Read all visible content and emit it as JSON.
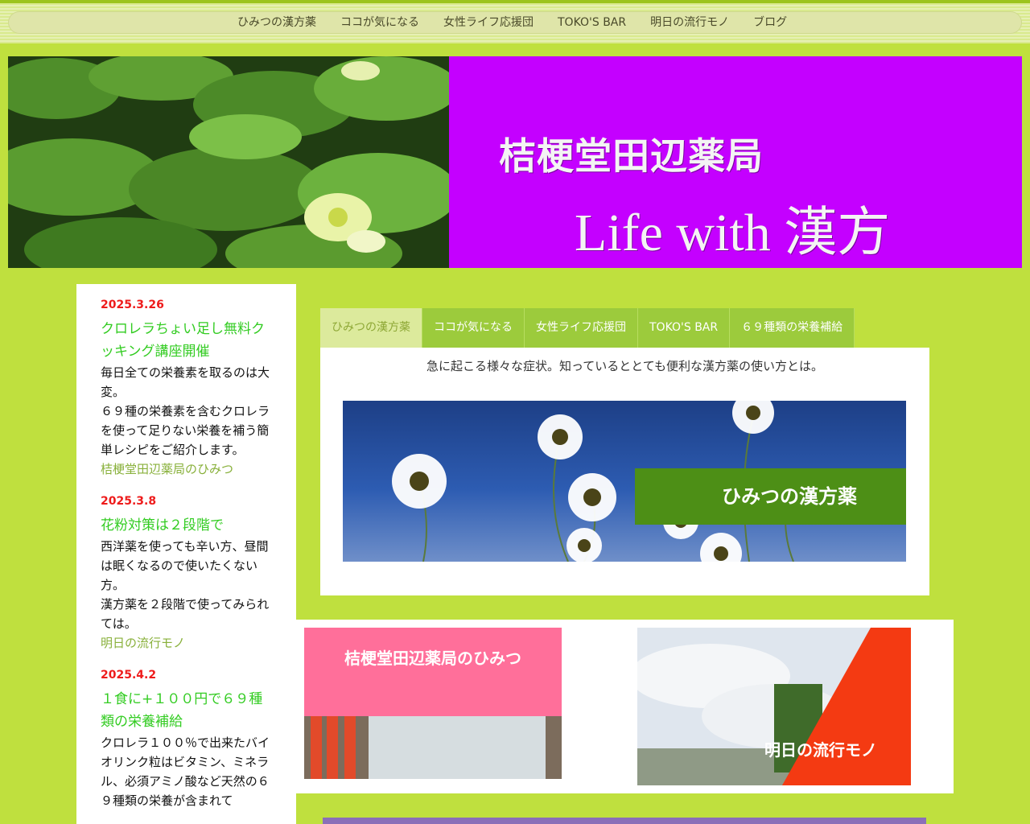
{
  "nav": {
    "items": [
      "ひみつの漢方薬",
      "ココが気になる",
      "女性ライフ応援団",
      "TOKO'S BAR",
      "明日の流行モノ",
      "ブログ"
    ]
  },
  "banner": {
    "title": "桔梗堂田辺薬局",
    "tagline": "Life with 漢方"
  },
  "sidebar": {
    "posts": [
      {
        "date": "2025.3.26",
        "title": "クロレラちょい足し無料クッキング講座開催",
        "body": "毎日全ての栄養素を取るのは大変。\n６９種の栄養素を含むクロレラを使って足りない栄養を補う簡単レシピをご紹介します。",
        "category": "桔梗堂田辺薬局のひみつ"
      },
      {
        "date": "2025.3.8",
        "title": "花粉対策は２段階で",
        "body": "西洋薬を使っても辛い方、昼間は眠くなるので使いたくない方。\n漢方薬を２段階で使ってみられては。",
        "category": "明日の流行モノ"
      },
      {
        "date": "2025.4.2",
        "title": "１食に+１００円で６９種類の栄養補給",
        "body": "クロレラ１００％で出来たバイオリンク粒はビタミン、ミネラル、必須アミノ酸など天然の６９種類の栄養が含まれて",
        "category": ""
      }
    ]
  },
  "tabs": {
    "items": [
      "ひみつの漢方薬",
      "ココが気になる",
      "女性ライフ応援団",
      "TOKO'S BAR",
      "６９種類の栄養補給"
    ],
    "active_index": 0,
    "description": "急に起こる様々な症状。知っているととても便利な漢方薬の使い方とは。",
    "image_label": "ひみつの漢方薬"
  },
  "cards": {
    "card1_label": "桔梗堂田辺薬局のひみつ",
    "card2_label": "明日の流行モノ"
  },
  "colors": {
    "background": "#bfe03e",
    "banner_purple": "#c400ff",
    "tab_green": "#9ccb3c",
    "date_red": "#ee1b1b",
    "post_title_green": "#33cc22"
  }
}
